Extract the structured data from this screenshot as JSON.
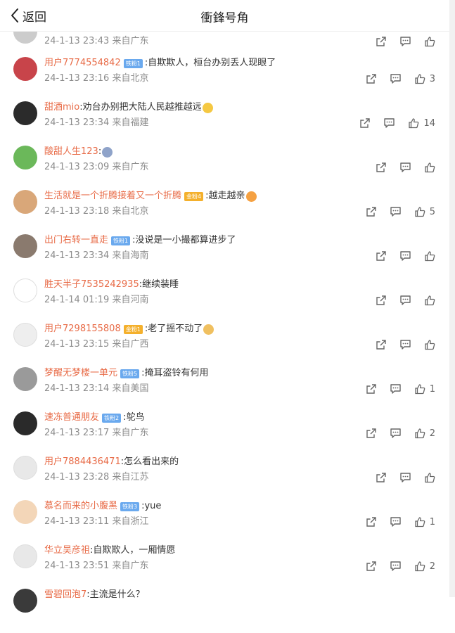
{
  "header": {
    "back_label": "返回",
    "title": "衝鋒号角"
  },
  "comments": [
    {
      "user": "",
      "badge": "",
      "badge_color": "",
      "text": "",
      "emoji": "",
      "meta": "24-1-13 23:43 来自广东",
      "likes": ""
    },
    {
      "user": "用户7774554842",
      "badge": "铁粉1",
      "badge_color": "blue",
      "text": ":自欺欺人，桓台办别丢人现眼了",
      "emoji": "",
      "meta": "24-1-13 23:16 来自北京",
      "likes": "3"
    },
    {
      "user": "甜酒mio",
      "badge": "",
      "badge_color": "",
      "text": ":劝台办别把大陆人民越推越远",
      "emoji": "smile",
      "meta": "24-1-13 23:34 来自福建",
      "likes": "14"
    },
    {
      "user": "酸甜人生123",
      "badge": "",
      "badge_color": "",
      "text": ":",
      "emoji": "face",
      "meta": "24-1-13 23:09 来自广东",
      "likes": ""
    },
    {
      "user": "生活就是一个折腾接着又一个折腾",
      "badge": "金粉4",
      "badge_color": "gold",
      "text": ":越走越亲",
      "emoji": "cry",
      "meta": "24-1-13 23:18 来自北京",
      "likes": "5"
    },
    {
      "user": "出门右转一直走",
      "badge": "铁粉1",
      "badge_color": "blue",
      "text": ":没说是一小撮都算进步了",
      "emoji": "",
      "meta": "24-1-13 23:34 来自海南",
      "likes": ""
    },
    {
      "user": "胜天半子7535242935",
      "badge": "",
      "badge_color": "",
      "text": ":继续装睡",
      "emoji": "",
      "meta": "24-1-14 01:19 来自河南",
      "likes": ""
    },
    {
      "user": "用户7298155808",
      "badge": "金粉1",
      "badge_color": "gold",
      "text": ":老了摇不动了",
      "emoji": "cat",
      "meta": "24-1-13 23:15 来自广西",
      "likes": ""
    },
    {
      "user": "梦醒无梦楼一单元",
      "badge": "铁粉5",
      "badge_color": "blue",
      "text": ":掩耳盗铃有何用",
      "emoji": "",
      "meta": "24-1-13 23:14 来自美国",
      "likes": "1"
    },
    {
      "user": "速冻普通朋友",
      "badge": "铁粉2",
      "badge_color": "blue",
      "text": ":鸵鸟",
      "emoji": "",
      "meta": "24-1-13 23:17 来自广东",
      "likes": "2"
    },
    {
      "user": "用户7884436471",
      "badge": "",
      "badge_color": "",
      "text": ":怎么看出来的",
      "emoji": "",
      "meta": "24-1-13 23:28 来自江苏",
      "likes": ""
    },
    {
      "user": "慕名而来的小腹黑",
      "badge": "铁粉3",
      "badge_color": "blue",
      "text": ":yue",
      "emoji": "",
      "meta": "24-1-13 23:11 来自浙江",
      "likes": "1"
    },
    {
      "user": "华立吴彦祖",
      "badge": "",
      "badge_color": "",
      "text": ":自欺欺人，一厢情愿",
      "emoji": "",
      "meta": "24-1-13 23:51 来自广东",
      "likes": "2"
    },
    {
      "user": "雪碧回泡7",
      "badge": "",
      "badge_color": "",
      "text": ":主流是什么？",
      "emoji": "",
      "meta": "",
      "likes": ""
    }
  ],
  "avatar_colors": [
    "#cccccc",
    "#c8444a",
    "#2b2b2b",
    "#6bb85a",
    "#d9a779",
    "#8a7a6e",
    "#ffffff",
    "#eeeeee",
    "#9a9a9a",
    "#2a2a2a",
    "#e8e8e8",
    "#f3d6b8",
    "#e8e8e8",
    "#3a3a3a"
  ],
  "emoji_colors": {
    "smile": "#f5c842",
    "face": "#8fa3c9",
    "cry": "#f5a142",
    "cat": "#f0c060"
  }
}
